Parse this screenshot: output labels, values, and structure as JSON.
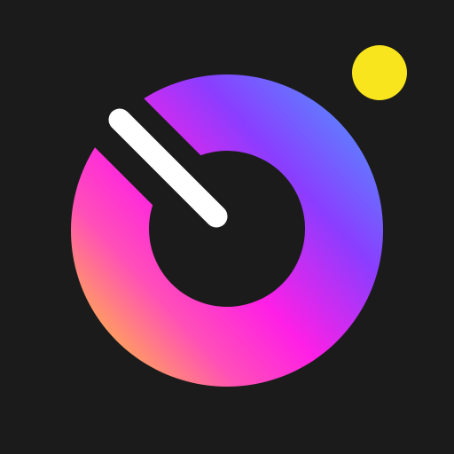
{
  "icon": {
    "icons": [
      "donut-ring-icon",
      "dial-needle-icon",
      "status-dot-icon"
    ],
    "colors": {
      "background": "#1b1b1b",
      "ring_gradient_blue": "#4f95ff",
      "ring_gradient_violet": "#8b3dff",
      "ring_gradient_magenta": "#ff1fe6",
      "ring_gradient_pink": "#ff4fb8",
      "ring_gradient_orange": "#ffb14a",
      "needle": "#ffffff",
      "dot": "#f9e51d"
    }
  }
}
